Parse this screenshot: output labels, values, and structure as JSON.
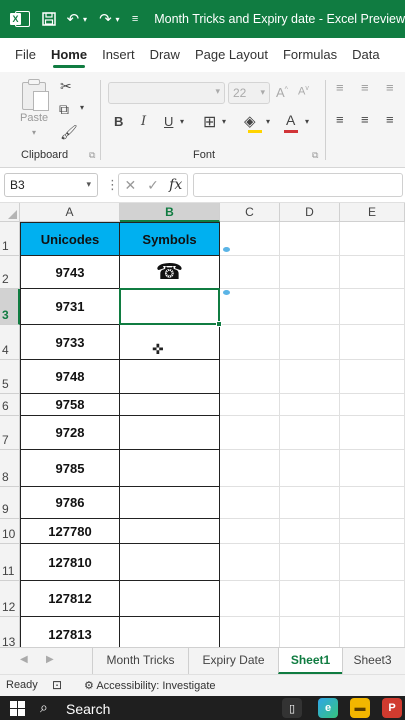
{
  "titlebar": {
    "title": "Month Tricks and Expiry date  -  Excel Preview",
    "bg": "#107c41"
  },
  "menu": {
    "tabs": [
      "File",
      "Home",
      "Insert",
      "Draw",
      "Page Layout",
      "Formulas",
      "Data"
    ],
    "active": "Home"
  },
  "ribbon": {
    "paste_label": "Paste",
    "clipboard_label": "Clipboard",
    "font_label": "Font",
    "font_size": "22"
  },
  "formula_bar": {
    "name_box": "B3",
    "fx": "fx",
    "formula": ""
  },
  "grid": {
    "columns": [
      "A",
      "B",
      "C",
      "D",
      "E"
    ],
    "selected_column": "B",
    "rows": [
      "1",
      "2",
      "3",
      "4",
      "5",
      "6",
      "7",
      "8",
      "9",
      "10",
      "11",
      "12",
      "13"
    ],
    "selected_row": "3",
    "header_bg": "#00b0f0",
    "table_headers": {
      "a": "Unicodes",
      "b": "Symbols"
    },
    "codes": [
      "9743",
      "9731",
      "9733",
      "9748",
      "9758",
      "9728",
      "9785",
      "9786",
      "127780",
      "127810",
      "127812",
      "127813"
    ],
    "symbols": [
      "☎",
      "",
      "",
      "",
      "",
      "",
      "",
      "",
      "",
      "",
      "",
      ""
    ]
  },
  "sheets": {
    "tabs": [
      "Month Tricks",
      "Expiry Date",
      "Sheet1",
      "Sheet3"
    ],
    "active": "Sheet1"
  },
  "status": {
    "ready": "Ready",
    "accessibility": "Accessibility: Investigate"
  },
  "taskbar": {
    "search": "Search"
  }
}
